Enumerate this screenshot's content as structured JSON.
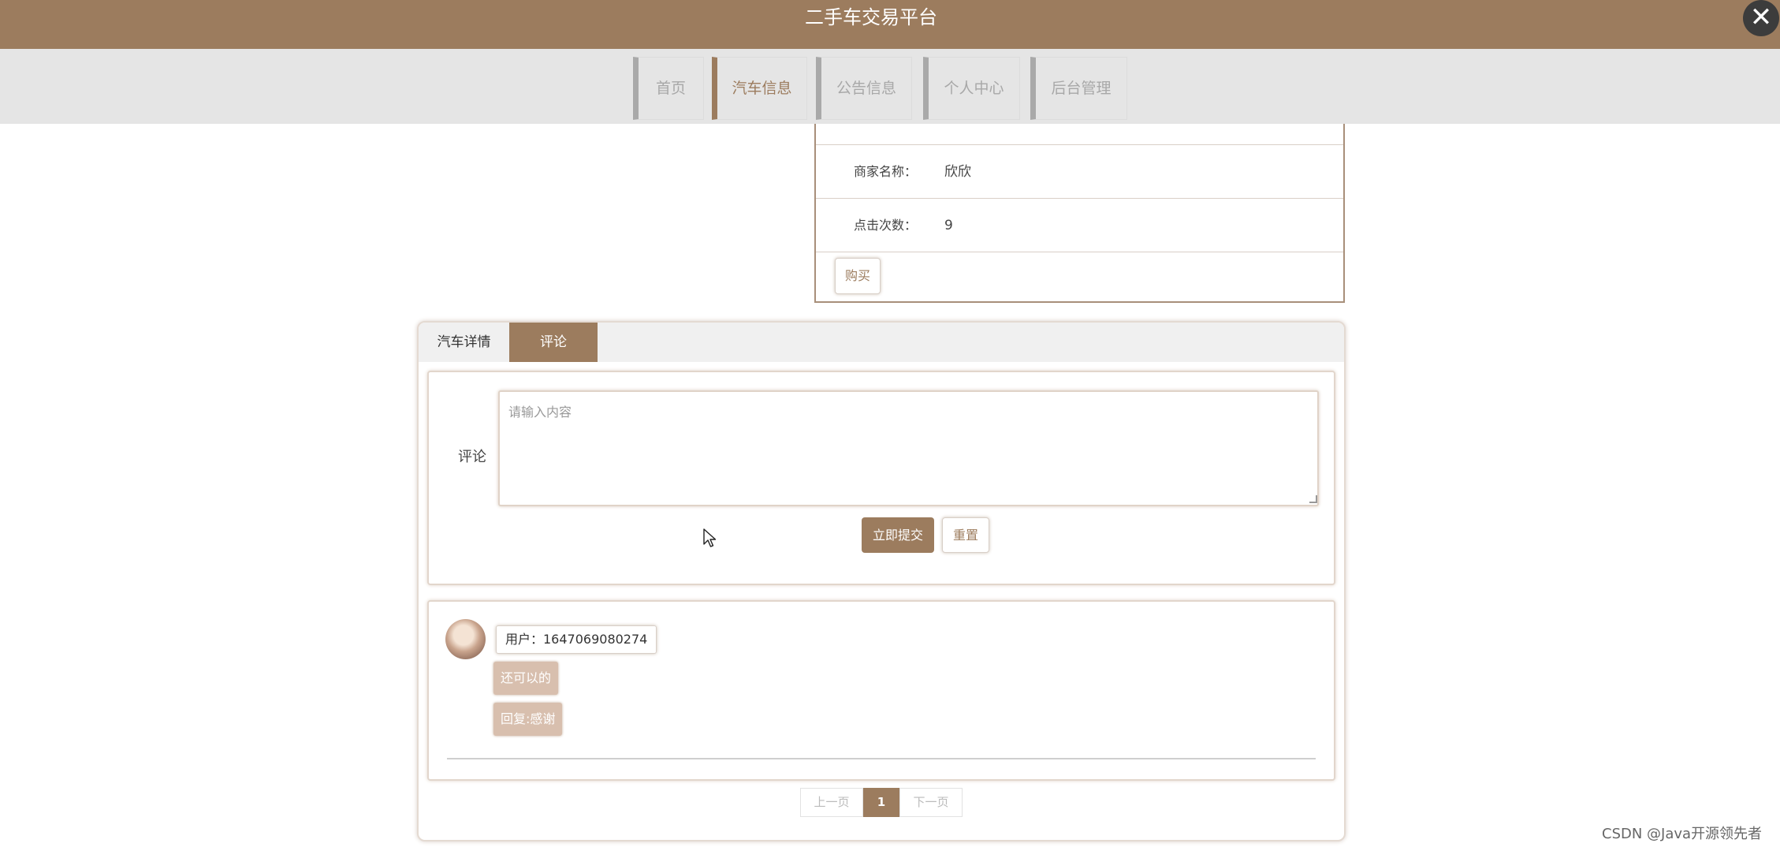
{
  "header": {
    "title": "二手车交易平台",
    "close_label": "✕"
  },
  "nav": {
    "items": [
      {
        "label": "首页"
      },
      {
        "label": "汽车信息",
        "active": true
      },
      {
        "label": "公告信息"
      },
      {
        "label": "个人中心"
      },
      {
        "label": "后台管理"
      }
    ]
  },
  "info": {
    "rows": [
      {
        "label": "商家名称：",
        "value": "欣欣"
      },
      {
        "label": "点击次数：",
        "value": "9"
      }
    ],
    "buy_label": "购买"
  },
  "tabs": {
    "items": [
      {
        "label": "汽车详情"
      },
      {
        "label": "评论",
        "active": true
      }
    ]
  },
  "comment_form": {
    "label": "评论",
    "placeholder": "请输入内容",
    "submit_label": "立即提交",
    "reset_label": "重置"
  },
  "comments": [
    {
      "user": "用户：1647069080274",
      "content": "还可以的",
      "reply": "回复:感谢"
    }
  ],
  "pagination": {
    "prev_label": "上一页",
    "current": "1",
    "next_label": "下一页"
  },
  "watermark": "CSDN @Java开源领先者",
  "colors": {
    "accent": "#9c7c5e",
    "bubble": "#d8bfae",
    "nav_bg": "#e5e5e5"
  }
}
